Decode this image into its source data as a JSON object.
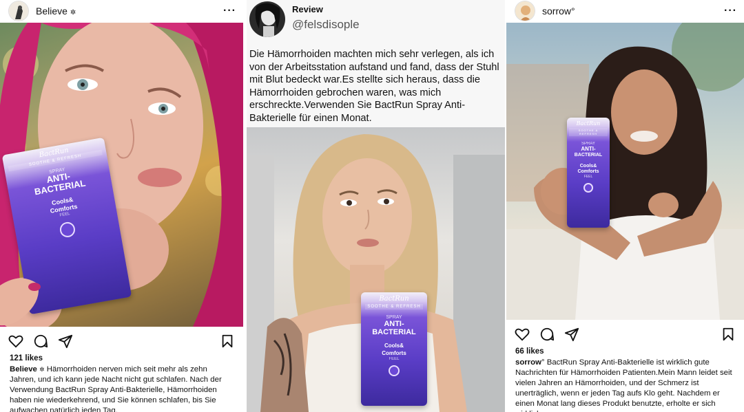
{
  "posts": [
    {
      "username": "Believe",
      "verified_mark": "✲",
      "likes": "121 likes",
      "caption_user": "Believe",
      "caption_mark": "✲",
      "caption": "Hämorrhoiden nerven mich seit mehr als zehn Jahren, und ich kann jede Nacht nicht gut schlafen. Nach der Verwendung BactRun Spray Anti-Bakterielle, Hämorrhoiden haben nie wiederkehrend, und Sie können schlafen, bis Sie aufwachen natürlich jeden Tag."
    },
    {
      "username": "sorrow",
      "verified_mark": "°",
      "likes": "66 likes",
      "caption_user": "sorrow",
      "caption_mark": "°",
      "caption": "BactRun Spray Anti-Bakterielle ist wirklich gute Nachrichten für Hämorrhoiden Patienten.Mein Mann leidet seit vielen Jahren an Hämorrhoiden, und der Schmerz ist unerträglich, wenn er jeden Tag aufs Klo geht. Nachdem er einen Monat lang dieses Produkt benutzte, erholte er sich wirklich."
    }
  ],
  "review": {
    "title": "Review",
    "handle": "@felsdisople",
    "text": "Die Hämorrhoiden machten mich sehr verlegen, als ich von der Arbeitsstation aufstand und fand, dass der Stuhl mit Blut bedeckt war.Es stellte sich heraus, dass die Hämorrhoiden gebrochen waren, was mich erschreckte.Verwenden Sie BactRun Spray Anti-Bakterielle für einen Monat."
  },
  "product": {
    "brand": "BactRun",
    "subline": "SOOTHE & REFRESH",
    "spray": "SPRAY",
    "main_line1": "ANTI-",
    "main_line2": "BACTERIAL",
    "cools1": "Cools&",
    "cools2": "Comforts",
    "feel": "FEEL"
  },
  "icons": {
    "more": "more-options-icon",
    "like": "heart-icon",
    "comment": "comment-icon",
    "share": "share-icon",
    "save": "bookmark-icon"
  }
}
